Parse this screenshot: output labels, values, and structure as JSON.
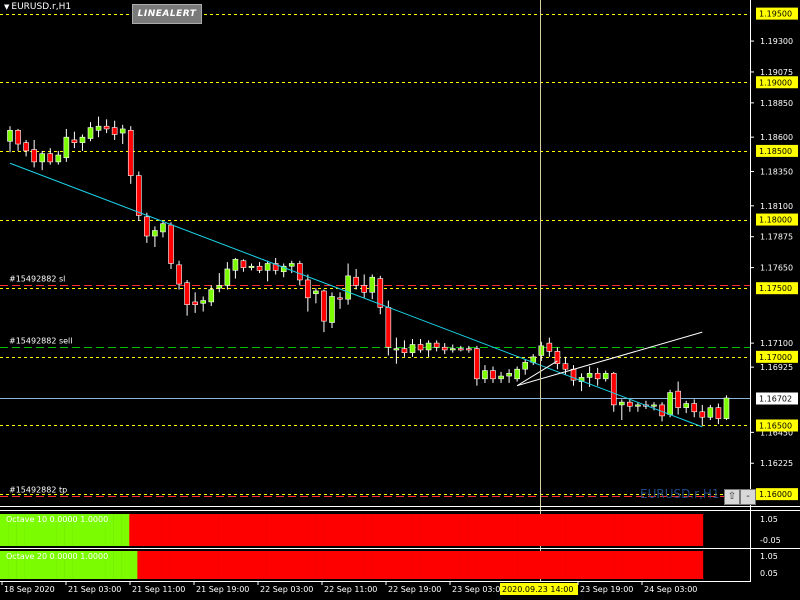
{
  "window": {
    "title": "EURUSD.r,H1",
    "line_alert_button": "LINEALERT",
    "watermark": "EURUSD.r,H1",
    "scroll_up_icon": "up-arrow-icon",
    "minus_icon": "minus-icon"
  },
  "colors": {
    "background": "#000000",
    "bull": "#7cfc00",
    "bear": "#ff0000",
    "trendline": "#19d2e6",
    "level": "#ffff00",
    "order_line": "#ff3030",
    "sell_line": "#00c000"
  },
  "price_axis": {
    "ticks": [
      "1.19300",
      "1.19075",
      "1.18850",
      "1.18600",
      "1.18350",
      "1.18100",
      "1.17875",
      "1.17650",
      "1.17100",
      "1.16925",
      "1.16450",
      "1.16225",
      "1.16000"
    ],
    "tick_values": [
      1.193,
      1.19075,
      1.1885,
      1.186,
      1.1835,
      1.181,
      1.17875,
      1.1765,
      1.171,
      1.16925,
      1.1645,
      1.16225,
      1.16
    ],
    "level_labels": [
      "1.19500",
      "1.19000",
      "1.18500",
      "1.18000",
      "1.17500",
      "1.17000",
      "1.16500",
      "1.16000"
    ],
    "level_values": [
      1.195,
      1.19,
      1.185,
      1.18,
      1.175,
      1.17,
      1.165,
      1.16
    ],
    "current_price_label": "1.16702",
    "current_price": 1.16702
  },
  "time_axis": {
    "labels": [
      "18 Sep 2020",
      "21 Sep 03:00",
      "21 Sep 11:00",
      "21 Sep 19:00",
      "22 Sep 03:00",
      "22 Sep 11:00",
      "22 Sep 19:00",
      "23 Sep 03:00",
      "2020.09.23 14:00",
      "23 Sep 19:00",
      "24 Sep 03:00"
    ],
    "crosshair_label": "2020.09.23 14:00"
  },
  "order_lines": [
    {
      "label": "#15492882 sl",
      "price": 1.1752,
      "kind": "sl"
    },
    {
      "label": "#15492882 sell",
      "price": 1.1707,
      "kind": "sell"
    },
    {
      "label": "#15492882 tp",
      "price": 1.1599,
      "kind": "tp"
    }
  ],
  "chart_data": {
    "type": "candlestick",
    "symbol": "EURUSD.r",
    "timeframe": "H1",
    "ylim": [
      1.1595,
      1.1957
    ],
    "candles": [
      {
        "o": 1.1857,
        "h": 1.1868,
        "l": 1.1849,
        "c": 1.1865
      },
      {
        "o": 1.1865,
        "h": 1.1866,
        "l": 1.185,
        "c": 1.1855
      },
      {
        "o": 1.1856,
        "h": 1.1858,
        "l": 1.1846,
        "c": 1.185
      },
      {
        "o": 1.1851,
        "h": 1.1858,
        "l": 1.1838,
        "c": 1.1842
      },
      {
        "o": 1.1842,
        "h": 1.185,
        "l": 1.1836,
        "c": 1.1848
      },
      {
        "o": 1.1848,
        "h": 1.1852,
        "l": 1.184,
        "c": 1.1842
      },
      {
        "o": 1.1842,
        "h": 1.185,
        "l": 1.184,
        "c": 1.1847
      },
      {
        "o": 1.1845,
        "h": 1.1866,
        "l": 1.1842,
        "c": 1.186
      },
      {
        "o": 1.1858,
        "h": 1.1864,
        "l": 1.1852,
        "c": 1.1856
      },
      {
        "o": 1.1856,
        "h": 1.1862,
        "l": 1.185,
        "c": 1.186
      },
      {
        "o": 1.1859,
        "h": 1.1871,
        "l": 1.1857,
        "c": 1.1867
      },
      {
        "o": 1.1865,
        "h": 1.1875,
        "l": 1.186,
        "c": 1.1868
      },
      {
        "o": 1.1868,
        "h": 1.1873,
        "l": 1.1863,
        "c": 1.1866
      },
      {
        "o": 1.1867,
        "h": 1.1872,
        "l": 1.1858,
        "c": 1.1862
      },
      {
        "o": 1.1863,
        "h": 1.1869,
        "l": 1.1855,
        "c": 1.1866
      },
      {
        "o": 1.1865,
        "h": 1.1868,
        "l": 1.1826,
        "c": 1.1832
      },
      {
        "o": 1.1832,
        "h": 1.1835,
        "l": 1.1799,
        "c": 1.1803
      },
      {
        "o": 1.1802,
        "h": 1.1805,
        "l": 1.1783,
        "c": 1.1788
      },
      {
        "o": 1.1788,
        "h": 1.1795,
        "l": 1.178,
        "c": 1.1792
      },
      {
        "o": 1.1791,
        "h": 1.1799,
        "l": 1.1787,
        "c": 1.1797
      },
      {
        "o": 1.1796,
        "h": 1.1798,
        "l": 1.1764,
        "c": 1.1768
      },
      {
        "o": 1.1767,
        "h": 1.177,
        "l": 1.1749,
        "c": 1.1753
      },
      {
        "o": 1.1754,
        "h": 1.1756,
        "l": 1.173,
        "c": 1.1738
      },
      {
        "o": 1.174,
        "h": 1.1747,
        "l": 1.1732,
        "c": 1.1738
      },
      {
        "o": 1.1739,
        "h": 1.1744,
        "l": 1.1733,
        "c": 1.1741
      },
      {
        "o": 1.174,
        "h": 1.1752,
        "l": 1.1737,
        "c": 1.1749
      },
      {
        "o": 1.175,
        "h": 1.1761,
        "l": 1.1747,
        "c": 1.1752
      },
      {
        "o": 1.1752,
        "h": 1.1769,
        "l": 1.1749,
        "c": 1.1764
      },
      {
        "o": 1.1763,
        "h": 1.1772,
        "l": 1.1757,
        "c": 1.1771
      },
      {
        "o": 1.177,
        "h": 1.1771,
        "l": 1.1762,
        "c": 1.1765
      },
      {
        "o": 1.1765,
        "h": 1.1768,
        "l": 1.1763,
        "c": 1.1766
      },
      {
        "o": 1.1766,
        "h": 1.1769,
        "l": 1.1761,
        "c": 1.1763
      },
      {
        "o": 1.1763,
        "h": 1.177,
        "l": 1.1755,
        "c": 1.1768
      },
      {
        "o": 1.1768,
        "h": 1.1772,
        "l": 1.176,
        "c": 1.1763
      },
      {
        "o": 1.1762,
        "h": 1.1768,
        "l": 1.1758,
        "c": 1.1766
      },
      {
        "o": 1.1766,
        "h": 1.177,
        "l": 1.1761,
        "c": 1.1768
      },
      {
        "o": 1.1768,
        "h": 1.177,
        "l": 1.1752,
        "c": 1.1756
      },
      {
        "o": 1.1756,
        "h": 1.176,
        "l": 1.1733,
        "c": 1.1743
      },
      {
        "o": 1.1746,
        "h": 1.175,
        "l": 1.1739,
        "c": 1.1748
      },
      {
        "o": 1.1748,
        "h": 1.1749,
        "l": 1.1718,
        "c": 1.1726
      },
      {
        "o": 1.1725,
        "h": 1.1747,
        "l": 1.1721,
        "c": 1.1744
      },
      {
        "o": 1.1743,
        "h": 1.1747,
        "l": 1.1735,
        "c": 1.1742
      },
      {
        "o": 1.1742,
        "h": 1.1768,
        "l": 1.1738,
        "c": 1.1759
      },
      {
        "o": 1.1758,
        "h": 1.1764,
        "l": 1.1749,
        "c": 1.1752
      },
      {
        "o": 1.1752,
        "h": 1.176,
        "l": 1.1743,
        "c": 1.1747
      },
      {
        "o": 1.1747,
        "h": 1.176,
        "l": 1.1742,
        "c": 1.1758
      },
      {
        "o": 1.1757,
        "h": 1.1759,
        "l": 1.1731,
        "c": 1.1736
      },
      {
        "o": 1.1736,
        "h": 1.1741,
        "l": 1.1701,
        "c": 1.1707
      },
      {
        "o": 1.1705,
        "h": 1.1714,
        "l": 1.1695,
        "c": 1.1706
      },
      {
        "o": 1.1706,
        "h": 1.1712,
        "l": 1.17,
        "c": 1.1703
      },
      {
        "o": 1.1703,
        "h": 1.1713,
        "l": 1.17,
        "c": 1.1709
      },
      {
        "o": 1.1709,
        "h": 1.1713,
        "l": 1.1703,
        "c": 1.1705
      },
      {
        "o": 1.1705,
        "h": 1.1712,
        "l": 1.17,
        "c": 1.171
      },
      {
        "o": 1.171,
        "h": 1.1712,
        "l": 1.1704,
        "c": 1.1707
      },
      {
        "o": 1.1707,
        "h": 1.171,
        "l": 1.1702,
        "c": 1.1705
      },
      {
        "o": 1.1705,
        "h": 1.1709,
        "l": 1.1703,
        "c": 1.1706
      },
      {
        "o": 1.1706,
        "h": 1.1708,
        "l": 1.1704,
        "c": 1.1705
      },
      {
        "o": 1.1706,
        "h": 1.1708,
        "l": 1.1703,
        "c": 1.1705
      },
      {
        "o": 1.1706,
        "h": 1.1708,
        "l": 1.1679,
        "c": 1.1684
      },
      {
        "o": 1.1684,
        "h": 1.1694,
        "l": 1.1681,
        "c": 1.169
      },
      {
        "o": 1.169,
        "h": 1.1693,
        "l": 1.1681,
        "c": 1.1684
      },
      {
        "o": 1.1684,
        "h": 1.1689,
        "l": 1.1681,
        "c": 1.1686
      },
      {
        "o": 1.1686,
        "h": 1.1691,
        "l": 1.1681,
        "c": 1.1688
      },
      {
        "o": 1.1684,
        "h": 1.1693,
        "l": 1.1682,
        "c": 1.1691
      },
      {
        "o": 1.1691,
        "h": 1.1698,
        "l": 1.1687,
        "c": 1.1696
      },
      {
        "o": 1.1696,
        "h": 1.1702,
        "l": 1.1694,
        "c": 1.17
      },
      {
        "o": 1.1701,
        "h": 1.1711,
        "l": 1.1697,
        "c": 1.1708
      },
      {
        "o": 1.171,
        "h": 1.1714,
        "l": 1.17,
        "c": 1.1704
      },
      {
        "o": 1.1704,
        "h": 1.1707,
        "l": 1.1691,
        "c": 1.1695
      },
      {
        "o": 1.1695,
        "h": 1.17,
        "l": 1.1687,
        "c": 1.1691
      },
      {
        "o": 1.1691,
        "h": 1.1694,
        "l": 1.1679,
        "c": 1.1683
      },
      {
        "o": 1.1682,
        "h": 1.1688,
        "l": 1.1675,
        "c": 1.1685
      },
      {
        "o": 1.1685,
        "h": 1.1693,
        "l": 1.1678,
        "c": 1.1688
      },
      {
        "o": 1.1688,
        "h": 1.1692,
        "l": 1.1679,
        "c": 1.1684
      },
      {
        "o": 1.1684,
        "h": 1.169,
        "l": 1.1682,
        "c": 1.1688
      },
      {
        "o": 1.1688,
        "h": 1.1689,
        "l": 1.166,
        "c": 1.1665
      },
      {
        "o": 1.1665,
        "h": 1.1669,
        "l": 1.1654,
        "c": 1.1667
      },
      {
        "o": 1.1667,
        "h": 1.1669,
        "l": 1.166,
        "c": 1.1664
      },
      {
        "o": 1.1664,
        "h": 1.1667,
        "l": 1.166,
        "c": 1.1665
      },
      {
        "o": 1.1665,
        "h": 1.1668,
        "l": 1.1662,
        "c": 1.1664
      },
      {
        "o": 1.1664,
        "h": 1.1667,
        "l": 1.1661,
        "c": 1.1665
      },
      {
        "o": 1.1665,
        "h": 1.1667,
        "l": 1.1653,
        "c": 1.1657
      },
      {
        "o": 1.1658,
        "h": 1.1676,
        "l": 1.1656,
        "c": 1.1674
      },
      {
        "o": 1.1675,
        "h": 1.1682,
        "l": 1.1658,
        "c": 1.1663
      },
      {
        "o": 1.1663,
        "h": 1.1668,
        "l": 1.1659,
        "c": 1.1666
      },
      {
        "o": 1.1666,
        "h": 1.1669,
        "l": 1.1656,
        "c": 1.166
      },
      {
        "o": 1.166,
        "h": 1.1665,
        "l": 1.165,
        "c": 1.1656
      },
      {
        "o": 1.1656,
        "h": 1.1665,
        "l": 1.1654,
        "c": 1.1663
      },
      {
        "o": 1.1663,
        "h": 1.1666,
        "l": 1.1651,
        "c": 1.1655
      },
      {
        "o": 1.1655,
        "h": 1.1672,
        "l": 1.1654,
        "c": 1.167
      }
    ],
    "trendlines": [
      {
        "color": "#19d2e6",
        "from": {
          "i": 0,
          "p": 1.1841
        },
        "to": {
          "i": 86,
          "p": 1.1649
        }
      },
      {
        "color": "#ffffff",
        "from": {
          "i": 63,
          "p": 1.1679
        },
        "to": {
          "i": 86,
          "p": 1.1718
        }
      },
      {
        "color": "#ffffff",
        "from": {
          "i": 63,
          "p": 1.1679
        },
        "to": {
          "i": 68,
          "p": 1.1697
        }
      }
    ],
    "indicators": [
      {
        "name": "Octave 10 0.0000 1.0000",
        "axis_ticks": [
          "1.05",
          "-0.05"
        ],
        "green_bars": 16,
        "total_bars": 87
      },
      {
        "name": "Octave 20 0.0000 1.0000",
        "axis_ticks": [
          "1.05",
          "0.05"
        ],
        "green_bars": 17,
        "total_bars": 87
      }
    ]
  }
}
